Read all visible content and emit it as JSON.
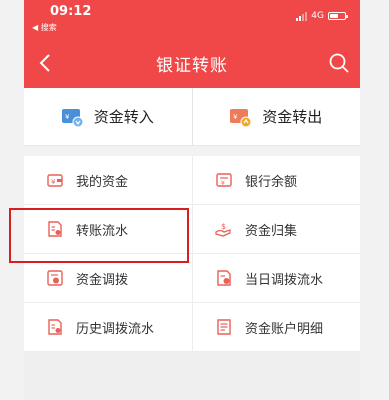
{
  "status_bar": {
    "time": "09:12",
    "back_app": "◀ 搜索",
    "network": "4G"
  },
  "navbar": {
    "title": "银证转账"
  },
  "transfer": {
    "in_label": "资金转入",
    "out_label": "资金转出"
  },
  "menu": {
    "items": [
      {
        "label": "我的资金",
        "icon": "wallet-icon"
      },
      {
        "label": "银行余额",
        "icon": "bank-balance-icon"
      },
      {
        "label": "转账流水",
        "icon": "transfer-record-icon"
      },
      {
        "label": "资金归集",
        "icon": "fund-collect-icon"
      },
      {
        "label": "资金调拨",
        "icon": "fund-allocate-icon"
      },
      {
        "label": "当日调拨流水",
        "icon": "daily-allocate-record-icon"
      },
      {
        "label": "历史调拨流水",
        "icon": "history-allocate-record-icon"
      },
      {
        "label": "资金账户明细",
        "icon": "account-detail-icon"
      }
    ]
  },
  "colors": {
    "brand": "#f04848",
    "highlight": "#d81e1e",
    "icon": "#e8605a"
  }
}
